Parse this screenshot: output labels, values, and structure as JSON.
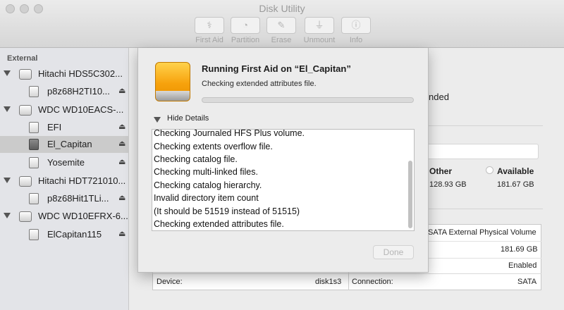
{
  "window": {
    "title": "Disk Utility"
  },
  "toolbar": {
    "first_aid": {
      "label": "First Aid",
      "icon": "stethoscope-icon"
    },
    "partition": {
      "label": "Partition",
      "icon": "pie-icon"
    },
    "erase": {
      "label": "Erase",
      "icon": "erase-icon"
    },
    "unmount": {
      "label": "Unmount",
      "icon": "unmount-icon"
    },
    "info": {
      "label": "Info",
      "icon": "info-icon"
    }
  },
  "sidebar": {
    "section": "External",
    "items": [
      {
        "label": "Hitachi HDS5C302...",
        "type": "disk"
      },
      {
        "label": "p8z68H2TI10...",
        "type": "volume",
        "eject": "⏏"
      },
      {
        "label": "WDC WD10EACS-...",
        "type": "disk"
      },
      {
        "label": "EFI",
        "type": "volume",
        "eject": "⏏"
      },
      {
        "label": "El_Capitan",
        "type": "volume",
        "eject": "⏏",
        "selected": true
      },
      {
        "label": "Yosemite",
        "type": "volume",
        "eject": "⏏"
      },
      {
        "label": "Hitachi HDT721010...",
        "type": "disk"
      },
      {
        "label": "p8z68Hit1TLi...",
        "type": "volume",
        "eject": "⏏"
      },
      {
        "label": "WDC WD10EFRX-6...",
        "type": "disk"
      },
      {
        "label": "ElCapitan115",
        "type": "volume",
        "eject": "⏏"
      }
    ]
  },
  "background": {
    "partial_text": "nded",
    "usage": {
      "other_label": "Other",
      "other_value": "128.93 GB",
      "available_label": "Available",
      "available_value": "181.67 GB"
    },
    "info": {
      "right_rows": [
        "SATA External Physical Volume",
        "181.69 GB",
        "Enabled"
      ],
      "device_label": "Device:",
      "device_value": "disk1s3",
      "connection_label": "Connection:",
      "connection_value": "SATA"
    }
  },
  "sheet": {
    "title": "Running First Aid on “El_Capitan”",
    "status": "Checking extended attributes file.",
    "progress": 0.0,
    "hide_details": "Hide Details",
    "log": [
      "Checking Journaled HFS Plus volume.",
      "Checking extents overflow file.",
      "Checking catalog file.",
      "Checking multi-linked files.",
      "Checking catalog hierarchy.",
      "Invalid directory item count",
      "(It should be 51519 instead of 51515)",
      "Checking extended attributes file."
    ],
    "done_label": "Done"
  }
}
